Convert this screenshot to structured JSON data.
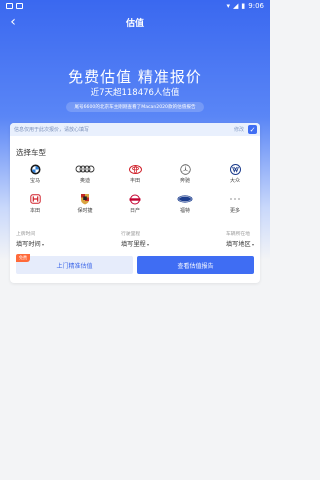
{
  "status": {
    "time": "9:06"
  },
  "nav": {
    "title": "估值"
  },
  "hero": {
    "headline": "免费估值 精准报价",
    "subhead": "近7天超118476人估值",
    "ticker": "尾号6600的北京车主刚刚查看了Macan2020款的估值报告"
  },
  "notice": {
    "text": "信息仅用于此次报价，请放心填写",
    "edit": "修改"
  },
  "brands": {
    "title": "选择车型",
    "items": [
      {
        "label": "宝马",
        "icon": "bmw-logo-icon"
      },
      {
        "label": "奥迪",
        "icon": "audi-logo-icon"
      },
      {
        "label": "丰田",
        "icon": "toyota-logo-icon"
      },
      {
        "label": "奔驰",
        "icon": "mercedes-logo-icon"
      },
      {
        "label": "大众",
        "icon": "volkswagen-logo-icon"
      },
      {
        "label": "本田",
        "icon": "honda-logo-icon"
      },
      {
        "label": "保时捷",
        "icon": "porsche-logo-icon"
      },
      {
        "label": "日产",
        "icon": "nissan-logo-icon"
      },
      {
        "label": "福特",
        "icon": "ford-logo-icon"
      },
      {
        "label": "更多",
        "icon": "more-dots-icon"
      }
    ]
  },
  "fields": {
    "date": {
      "label": "上牌时间",
      "value": "填写时间"
    },
    "mileage": {
      "label": "行驶里程",
      "value": "填写里程"
    },
    "location": {
      "label": "车辆所在地",
      "value": "填写地区"
    }
  },
  "buttons": {
    "free_badge": "免费",
    "home": "上门精准估值",
    "report": "查看估值报告"
  },
  "colors": {
    "primary": "#3f6df3",
    "badge": "#ff6a3a"
  }
}
